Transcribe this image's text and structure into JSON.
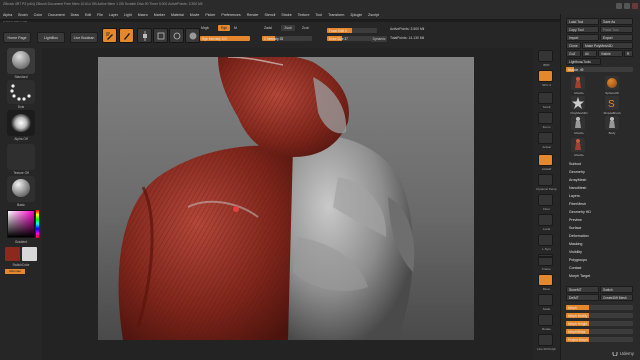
{
  "window": {
    "title": "ZBrush 4R7 P3 (x64)  ZBrush Document   Free Mem 10.614 GB  Active Mem 1 GB  Scratch Disk 50  Timer 0.002  ActivePoints: 3.500 Mil",
    "info": "0.000 0.025 0.770"
  },
  "menu": {
    "items": [
      "Alpha",
      "Brush",
      "Color",
      "Document",
      "Draw",
      "Edit",
      "File",
      "Layer",
      "Light",
      "Macro",
      "Marker",
      "Material",
      "Movie",
      "Picker",
      "Preferences",
      "Render",
      "Stencil",
      "Stroke",
      "Texture",
      "Tool",
      "Transform",
      "Zplugin",
      "Zscript"
    ]
  },
  "toolbar": {
    "home_page": "Home Page",
    "lightbox": "LightBox",
    "live_boolean": "Live Boolean",
    "edit": "Edit",
    "draw": "Draw",
    "move": "Move",
    "scale": "Scale",
    "rotate": "Rotate",
    "mrgb": "Mrgb",
    "rgb": "Rgb",
    "m": "M",
    "zadd": "Zadd",
    "zsub": "Zsub",
    "zcut": "Zcut",
    "rgb_intensity": "Rgb Intensity 100",
    "rgb_intensity_value": 1.0,
    "z_intensity": "Z Intensity 25",
    "z_intensity_value": 0.25,
    "focal_shift": "Focal Shift 0",
    "focal_shift_value": 0.5,
    "draw_size": "Draw Size 37",
    "draw_size_value": 0.3,
    "dynamic": "Dynamic",
    "active_points": "ActivePoints: 3.500 Mil",
    "total_points": "TotalPoints: 14.130 Mil"
  },
  "left_shelf": {
    "brush_label": "Standard",
    "stroke_label": "Dots",
    "alpha_label": "Alpha Off",
    "texture_label": "Texture Off",
    "material_label": "Basic",
    "gradient_label": "Gradient",
    "switch_color": "SwitchColor",
    "alternate": "Alternate",
    "main_color": "#8b2a1c",
    "secondary_color": "#d8d8d8"
  },
  "right_shelf": {
    "items": [
      "BPR",
      "SPix 3",
      "Scroll",
      "Zoom",
      "Actual",
      "AAHalf",
      "Dynamic Persp",
      "Floor",
      "Local",
      "L.Sym",
      "Frame",
      "Move",
      "Scale",
      "Rotate",
      "Line Fill PolyF",
      "Transp",
      "Ghost",
      "Solo",
      "Xpose"
    ]
  },
  "tray": {
    "load_tool": "Load Tool",
    "save_as": "Save As",
    "copy_tool": "Copy Tool",
    "paste_tool": "Paste Tool",
    "import": "Import",
    "export": "Export",
    "clone": "Clone",
    "make_polymesh": "Make PolyMesh3D",
    "goz": "GoZ",
    "all": "All",
    "visible": "Visible",
    "r": "R",
    "lightbox_tools": "Lightbox▸Tools",
    "tool_name": "Muscle. 49",
    "tools": [
      "Muscle",
      "Sphere3D",
      "PolyMesh3D",
      "SimpleBrush",
      "Muscle",
      "Body",
      "Muscle"
    ],
    "subpanels": [
      "Subtool",
      "Geometry",
      "ArrayMesh",
      "NanoMesh",
      "Layers",
      "FiberMesh",
      "Geometry HD",
      "Preview",
      "Surface",
      "Deformation",
      "Masking",
      "Visibility",
      "Polygroups",
      "Contact",
      "Morph Target"
    ],
    "storemt": "StoreMT",
    "switch": "Switch",
    "delmt": "DelMT",
    "create_diff_mesh": "CreateDiff Mesh",
    "bottom": [
      "Morph",
      "Morph Modify",
      "Morph Height",
      "MorphStrips",
      "Project Morph"
    ]
  },
  "watermark": "Udemy"
}
